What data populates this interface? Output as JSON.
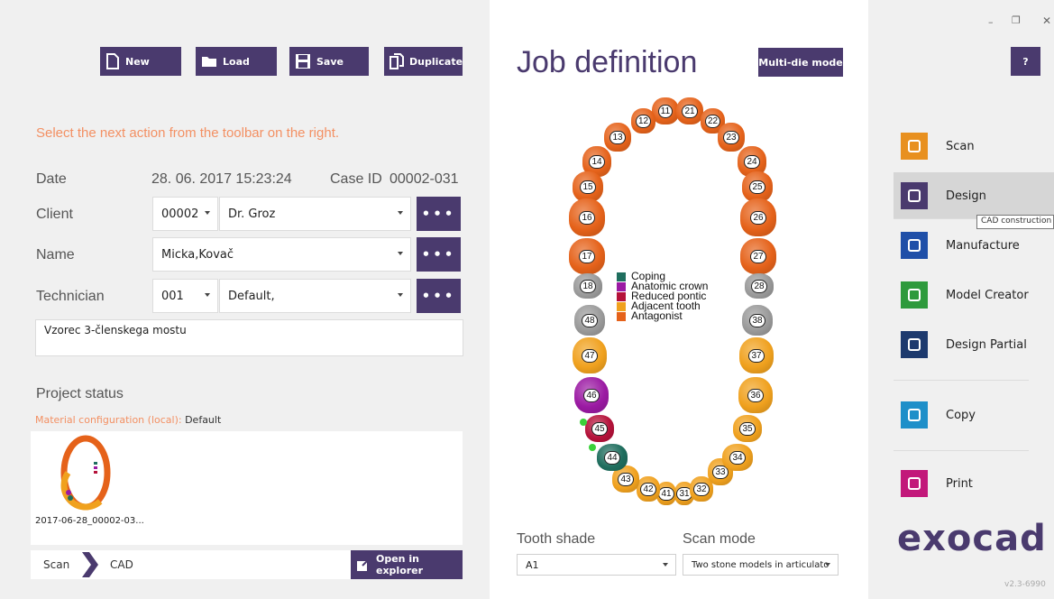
{
  "toolbar": {
    "new": "New",
    "load": "Load",
    "save": "Save",
    "duplicate": "Duplicate"
  },
  "hint": "Select the next action from the toolbar on the right.",
  "form": {
    "date_label": "Date",
    "date_value": "28. 06. 2017 15:23:24",
    "case_label": "Case ID",
    "case_value": "00002-031",
    "client_label": "Client",
    "client_code": "00002",
    "client_name": "Dr. Groz",
    "name_label": "Name",
    "name_value": "Micka,Kovač",
    "tech_label": "Technician",
    "tech_code": "001",
    "tech_name": "Default,",
    "notes": "Vzorec 3-členskega mostu",
    "more": "•••"
  },
  "project": {
    "title": "Project status",
    "material_label": "Material configuration (local):",
    "material_value": "Default",
    "thumb_caption": "2017-06-28_00002-03..."
  },
  "steps": {
    "scan": "Scan",
    "cad": "CAD",
    "open": "Open in explorer"
  },
  "job": {
    "title": "Job definition",
    "multidie": "Multi-die mode",
    "legend": [
      {
        "label": "Coping",
        "color": "#1f6e5e"
      },
      {
        "label": "Anatomic crown",
        "color": "#9b1aa3"
      },
      {
        "label": "Reduced pontic",
        "color": "#b5123a"
      },
      {
        "label": "Adjacent tooth",
        "color": "#f0a11e"
      },
      {
        "label": "Antagonist",
        "color": "#e5621a"
      }
    ],
    "upper": [
      "11",
      "12",
      "13",
      "14",
      "15",
      "16",
      "17",
      "18",
      "21",
      "22",
      "23",
      "24",
      "25",
      "26",
      "27",
      "28"
    ],
    "lower": [
      "31",
      "32",
      "33",
      "34",
      "35",
      "36",
      "37",
      "38",
      "41",
      "42",
      "43",
      "44",
      "45",
      "46",
      "47",
      "48"
    ],
    "shade_label": "Tooth shade",
    "shade_value": "A1",
    "scan_label": "Scan mode",
    "scan_value": "Two stone models in articulato"
  },
  "menu": {
    "help": "?",
    "items": [
      {
        "label": "Scan",
        "icon": "scan-icon",
        "color": "#e8901f"
      },
      {
        "label": "Design",
        "icon": "design-icon",
        "color": "#4a3a6e"
      },
      {
        "label": "Manufacture",
        "icon": "manufacture-icon",
        "color": "#1f4fa8"
      },
      {
        "label": "Model Creator",
        "icon": "model-creator-icon",
        "color": "#2e9a3c"
      },
      {
        "label": "Design Partial",
        "icon": "design-partial-icon",
        "color": "#1d3a6e"
      },
      {
        "label": "Copy",
        "icon": "copy-icon",
        "color": "#1e8fc9"
      },
      {
        "label": "Print",
        "icon": "print-icon",
        "color": "#c2187a"
      }
    ],
    "tooltip": "CAD construction",
    "logo": "exocad",
    "version": "v2.3-6990"
  }
}
